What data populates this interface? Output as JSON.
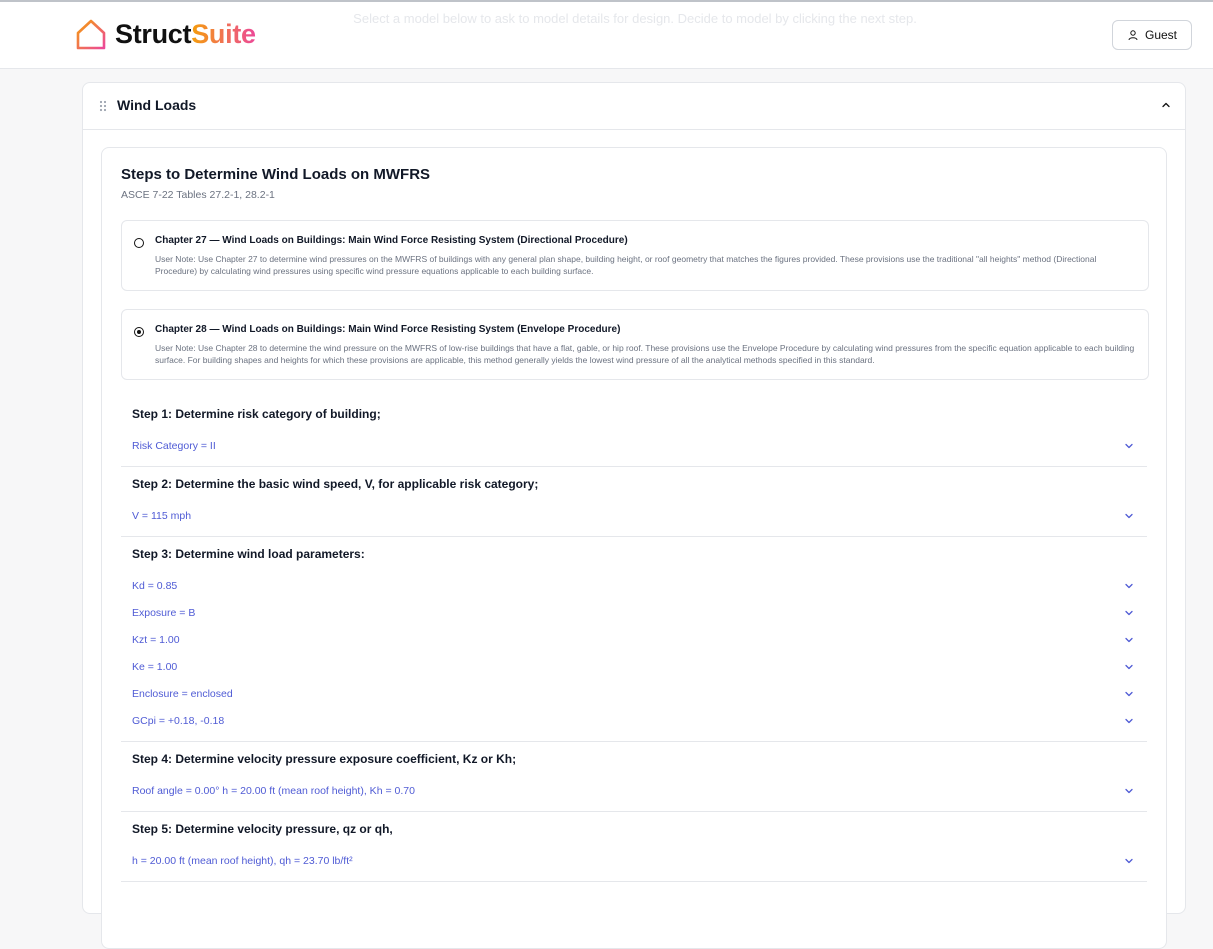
{
  "header": {
    "brand_part1": "Struct",
    "brand_part2": "Suite",
    "guest_label": "Guest",
    "ghost_text": "Select a model below to ask to model details for design. Decide to model by clicking the next step."
  },
  "panel": {
    "title": "Wind Loads"
  },
  "card": {
    "title": "Steps to Determine Wind Loads on MWFRS",
    "subtitle": "ASCE 7-22 Tables 27.2-1, 28.2-1",
    "options": [
      {
        "title": "Chapter 27 — Wind Loads on Buildings: Main Wind Force Resisting System (Directional Procedure)",
        "note": "User Note: Use Chapter 27 to determine wind pressures on the MWFRS of buildings with any general plan shape, building height, or roof geometry that matches the figures provided. These provisions use the traditional \"all heights\" method (Directional Procedure) by calculating wind pressures using specific wind pressure equations applicable to each building surface.",
        "selected": false
      },
      {
        "title": "Chapter 28 — Wind Loads on Buildings: Main Wind Force Resisting System (Envelope Procedure)",
        "note": "User Note: Use Chapter 28 to determine the wind pressure on the MWFRS of low-rise buildings that have a flat, gable, or hip roof. These provisions use the Envelope Procedure by calculating wind pressures from the specific equation applicable to each building surface. For building shapes and heights for which these provisions are applicable, this method generally yields the lowest wind pressure of all the analytical methods specified in this standard.",
        "selected": true
      }
    ],
    "steps": [
      {
        "title": "Step 1: Determine risk category of building;",
        "rows": [
          "Risk Category = II"
        ]
      },
      {
        "title": "Step 2: Determine the basic wind speed, V, for applicable risk category;",
        "rows": [
          "V = 115 mph"
        ]
      },
      {
        "title": "Step 3: Determine wind load parameters:",
        "rows": [
          "Kd = 0.85",
          "Exposure = B",
          "Kzt = 1.00",
          "Ke = 1.00",
          "Enclosure = enclosed",
          "GCpi = +0.18, -0.18"
        ]
      },
      {
        "title": "Step 4: Determine velocity pressure exposure coefficient, Kz or Kh;",
        "rows": [
          "Roof angle = 0.00° h = 20.00 ft (mean roof height), Kh = 0.70"
        ]
      },
      {
        "title": "Step 5: Determine velocity pressure, qz or qh,",
        "rows": [
          "h = 20.00 ft (mean roof height), qh = 23.70 lb/ft²"
        ]
      }
    ]
  },
  "colors": {
    "accent": "#4f5bd5",
    "brand_start": "#f59e0b",
    "brand_end": "#ec4899"
  }
}
